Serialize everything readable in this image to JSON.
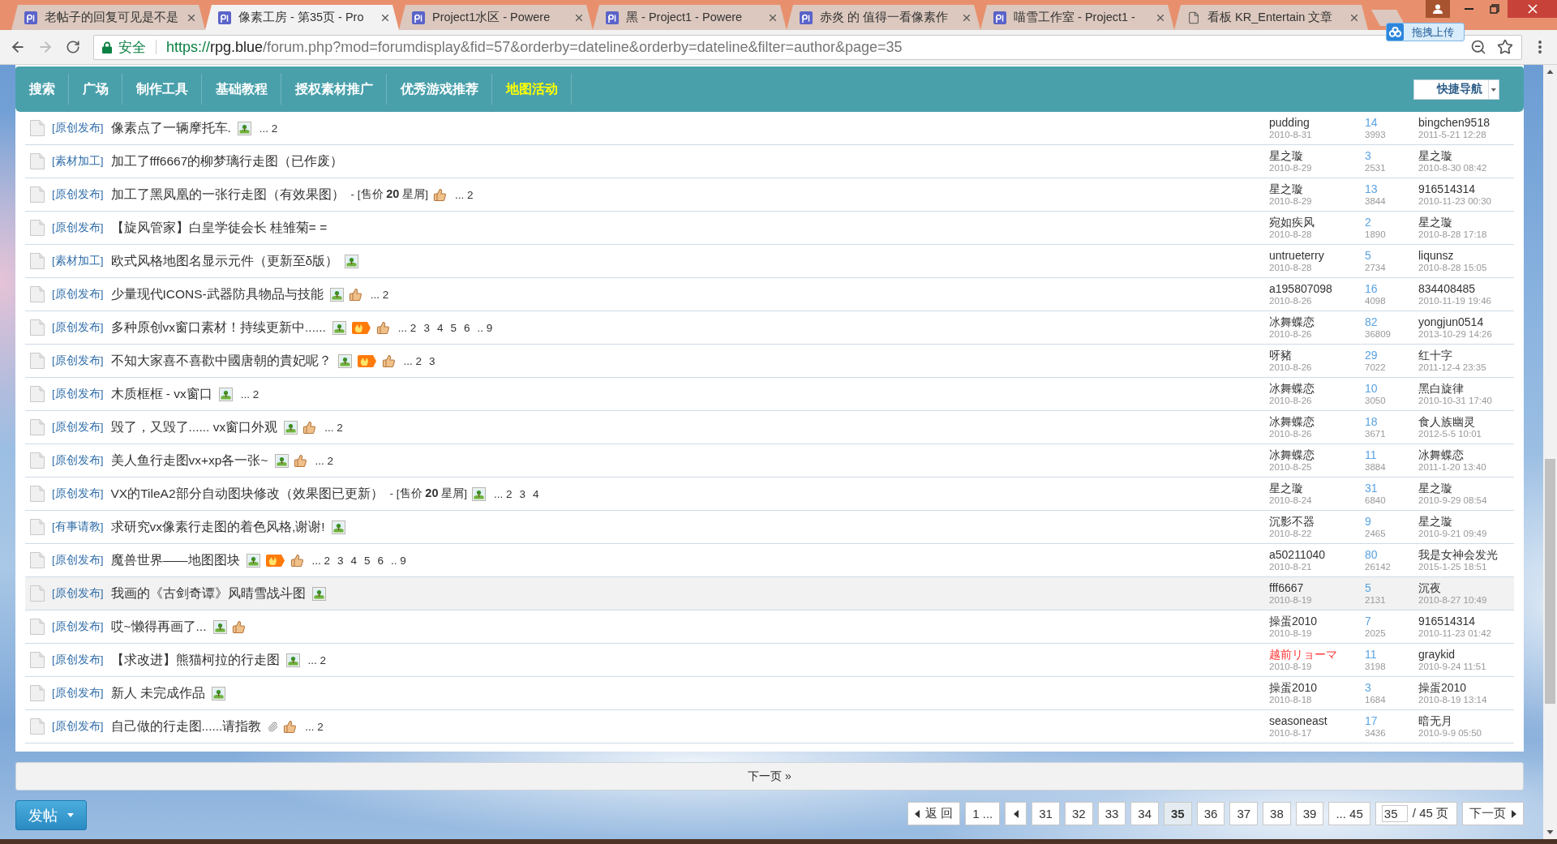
{
  "browser": {
    "tabs": [
      {
        "title": "老帖子的回复可见是不是",
        "kind": "site",
        "selected": false
      },
      {
        "title": "像素工房 - 第35页 - Pro",
        "kind": "site",
        "selected": true
      },
      {
        "title": "Project1水区 - Powere",
        "kind": "site",
        "selected": false
      },
      {
        "title": "黑 - Project1 - Powere",
        "kind": "site",
        "selected": false
      },
      {
        "title": "赤炎 的 值得一看像素作",
        "kind": "site",
        "selected": false
      },
      {
        "title": "喵雪工作室 - Project1 -",
        "kind": "site",
        "selected": false
      },
      {
        "title": "看板 KR_Entertain 文章",
        "kind": "page",
        "selected": false
      }
    ],
    "nav_buttons": [
      {
        "kind": "back",
        "disabled": false
      },
      {
        "kind": "forward",
        "disabled": true
      },
      {
        "kind": "reload",
        "disabled": false
      }
    ],
    "address_bar": {
      "security_label": "安全",
      "scheme": "https://",
      "host": "rpg.blue",
      "path": "/forum.php?mod=forumdisplay&fid=57&orderby=dateline&orderby=dateline&filter=author&page=35"
    },
    "upload_widget": {
      "label": "拖拽上传"
    }
  },
  "nav": {
    "items": [
      {
        "label": "搜索",
        "selected": false
      },
      {
        "label": "广场",
        "selected": false
      },
      {
        "label": "制作工具",
        "selected": false
      },
      {
        "label": "基础教程",
        "selected": false
      },
      {
        "label": "授权素材推广",
        "selected": false
      },
      {
        "label": "优秀游戏推荐",
        "selected": false
      },
      {
        "label": "地图活动",
        "selected": true
      }
    ],
    "quick_nav": "快捷导航"
  },
  "threads": [
    {
      "category": "[原创发布]",
      "title": "像素点了一辆摩托车.",
      "icons": [
        {
          "kind": "image"
        }
      ],
      "pages": [
        "... 2"
      ],
      "author": {
        "name": "pudding",
        "color": "#333333"
      },
      "date": "2010-8-31",
      "replies": "14",
      "views": "3993",
      "last_poster": "bingchen9518",
      "last_time": "2011-5-21 12:28",
      "highlighted": false
    },
    {
      "category": "[素材加工]",
      "title": "加工了fff6667的柳梦璃行走图（已作废）",
      "author": {
        "name": "星之璇",
        "color": "#333333"
      },
      "date": "2010-8-29",
      "replies": "3",
      "views": "2531",
      "last_poster": "星之璇",
      "last_time": "2010-8-30 08:42",
      "highlighted": false
    },
    {
      "category": "[原创发布]",
      "title": "加工了黑凤凰的一张行走图（有效果图）",
      "price": "- [售价 **20** 星屑]",
      "icons": [
        {
          "kind": "thumb"
        }
      ],
      "pages": [
        "... 2"
      ],
      "author": {
        "name": "星之璇",
        "color": "#333333"
      },
      "date": "2010-8-29",
      "replies": "13",
      "views": "3844",
      "last_poster": "916514314",
      "last_time": "2010-11-23 00:30",
      "highlighted": false
    },
    {
      "category": "[原创发布]",
      "title": "【旋风管家】白皇学徒会长 桂雏菊= =",
      "author": {
        "name": "宛如疾风",
        "color": "#333333"
      },
      "date": "2010-8-28",
      "replies": "2",
      "views": "1890",
      "last_poster": "星之璇",
      "last_time": "2010-8-28 17:18",
      "highlighted": false
    },
    {
      "category": "[素材加工]",
      "title": "欧式风格地图名显示元件（更新至δ版）",
      "icons": [
        {
          "kind": "image"
        }
      ],
      "author": {
        "name": "untrueterry",
        "color": "#333333"
      },
      "date": "2010-8-28",
      "replies": "5",
      "views": "2734",
      "last_poster": "liqunsz",
      "last_time": "2010-8-28 15:05",
      "highlighted": false
    },
    {
      "category": "[原创发布]",
      "title": "少量现代ICONS-武器防具物品与技能",
      "icons": [
        {
          "kind": "image"
        },
        {
          "kind": "thumb"
        }
      ],
      "pages": [
        "... 2"
      ],
      "author": {
        "name": "a195807098",
        "color": "#333333"
      },
      "date": "2010-8-26",
      "replies": "16",
      "views": "4098",
      "last_poster": "834408485",
      "last_time": "2010-11-19 19:46",
      "highlighted": false
    },
    {
      "category": "[原创发布]",
      "title": "多种原创vx窗口素材！持续更新中......",
      "icons": [
        {
          "kind": "image"
        },
        {
          "kind": "hot"
        },
        {
          "kind": "thumb"
        }
      ],
      "pages": [
        "... 2",
        "3",
        "4",
        "5",
        "6",
        ".. 9"
      ],
      "author": {
        "name": "冰舞蝶恋",
        "color": "#333333"
      },
      "date": "2010-8-26",
      "replies": "82",
      "views": "36809",
      "last_poster": "yongjun0514",
      "last_time": "2013-10-29 14:26",
      "highlighted": false
    },
    {
      "category": "[原创发布]",
      "title": "不知大家喜不喜歡中國唐朝的貴妃呢？",
      "icons": [
        {
          "kind": "image"
        },
        {
          "kind": "hot"
        },
        {
          "kind": "thumb"
        }
      ],
      "pages": [
        "... 2",
        "3"
      ],
      "author": {
        "name": "呀豬",
        "color": "#333333"
      },
      "date": "2010-8-26",
      "replies": "29",
      "views": "7022",
      "last_poster": "红十字",
      "last_time": "2011-12-4 23:35",
      "highlighted": false
    },
    {
      "category": "[原创发布]",
      "title": "木质框框 - vx窗口",
      "icons": [
        {
          "kind": "image"
        }
      ],
      "pages": [
        "... 2"
      ],
      "author": {
        "name": "冰舞蝶恋",
        "color": "#333333"
      },
      "date": "2010-8-26",
      "replies": "10",
      "views": "3050",
      "last_poster": "黑白旋律",
      "last_time": "2010-10-31 17:40",
      "highlighted": false
    },
    {
      "category": "[原创发布]",
      "title": "毁了，又毁了...... vx窗口外观",
      "icons": [
        {
          "kind": "image"
        },
        {
          "kind": "thumb"
        }
      ],
      "pages": [
        "... 2"
      ],
      "author": {
        "name": "冰舞蝶恋",
        "color": "#333333"
      },
      "date": "2010-8-26",
      "replies": "18",
      "views": "3671",
      "last_poster": "食人族幽灵",
      "last_time": "2012-5-5 10:01",
      "highlighted": false
    },
    {
      "category": "[原创发布]",
      "title": "美人鱼行走图vx+xp各一张~",
      "icons": [
        {
          "kind": "image"
        },
        {
          "kind": "thumb"
        }
      ],
      "pages": [
        "... 2"
      ],
      "author": {
        "name": "冰舞蝶恋",
        "color": "#333333"
      },
      "date": "2010-8-25",
      "replies": "11",
      "views": "3884",
      "last_poster": "冰舞蝶恋",
      "last_time": "2011-1-20 13:40",
      "highlighted": false
    },
    {
      "category": "[原创发布]",
      "title": "VX的TileA2部分自动图块修改（效果图已更新）",
      "price": "- [售价 **20** 星屑]",
      "icons": [
        {
          "kind": "image"
        }
      ],
      "pages": [
        "... 2",
        "3",
        "4"
      ],
      "author": {
        "name": "星之璇",
        "color": "#333333"
      },
      "date": "2010-8-24",
      "replies": "31",
      "views": "6840",
      "last_poster": "星之璇",
      "last_time": "2010-9-29 08:54",
      "highlighted": false
    },
    {
      "category": "[有事请教]",
      "title": "求研究vx像素行走图的着色风格,谢谢!",
      "icons": [
        {
          "kind": "image"
        }
      ],
      "author": {
        "name": "沉影不器",
        "color": "#333333"
      },
      "date": "2010-8-22",
      "replies": "9",
      "views": "2465",
      "last_poster": "星之璇",
      "last_time": "2010-9-21 09:49",
      "highlighted": false
    },
    {
      "category": "[原创发布]",
      "title": "魔兽世界——地图图块",
      "icons": [
        {
          "kind": "image"
        },
        {
          "kind": "hot"
        },
        {
          "kind": "thumb"
        }
      ],
      "pages": [
        "... 2",
        "3",
        "4",
        "5",
        "6",
        ".. 9"
      ],
      "author": {
        "name": "a50211040",
        "color": "#333333"
      },
      "date": "2010-8-21",
      "replies": "80",
      "views": "26142",
      "last_poster": "我是女神会发光",
      "last_time": "2015-1-25 18:51",
      "highlighted": false
    },
    {
      "category": "[原创发布]",
      "title": "我画的《古剑奇谭》风晴雪战斗图",
      "icons": [
        {
          "kind": "image"
        }
      ],
      "author": {
        "name": "fff6667",
        "color": "#333333"
      },
      "date": "2010-8-19",
      "replies": "5",
      "views": "2131",
      "last_poster": "沉夜",
      "last_time": "2010-8-27 10:49",
      "highlighted": true
    },
    {
      "category": "[原创发布]",
      "title": "哎~懒得再画了...",
      "icons": [
        {
          "kind": "image"
        },
        {
          "kind": "thumb"
        }
      ],
      "author": {
        "name": "操蛋2010",
        "color": "#333333"
      },
      "date": "2010-8-19",
      "replies": "7",
      "views": "2025",
      "last_poster": "916514314",
      "last_time": "2010-11-23 01:42",
      "highlighted": false
    },
    {
      "category": "[原创发布]",
      "title": "【求改进】熊猫柯拉的行走图",
      "icons": [
        {
          "kind": "image"
        }
      ],
      "pages": [
        "... 2"
      ],
      "author": {
        "name": "越前リョーマ",
        "color": "#ff3333"
      },
      "date": "2010-8-19",
      "replies": "11",
      "views": "3198",
      "last_poster": "graykid",
      "last_time": "2010-9-24 11:51",
      "highlighted": false
    },
    {
      "category": "[原创发布]",
      "title": "新人 未完成作品",
      "icons": [
        {
          "kind": "image"
        }
      ],
      "author": {
        "name": "操蛋2010",
        "color": "#333333"
      },
      "date": "2010-8-18",
      "replies": "3",
      "views": "1684",
      "last_poster": "操蛋2010",
      "last_time": "2010-8-19 13:14",
      "highlighted": false
    },
    {
      "category": "[原创发布]",
      "title": "自己做的行走图......请指教",
      "icons": [
        {
          "kind": "attachment"
        },
        {
          "kind": "thumb"
        }
      ],
      "pages": [
        "... 2"
      ],
      "author": {
        "name": "seasoneast",
        "color": "#333333"
      },
      "date": "2010-8-17",
      "replies": "17",
      "views": "3436",
      "last_poster": "暗无月",
      "last_time": "2010-9-9 05:50",
      "highlighted": false
    }
  ],
  "next_page": "下一页 »",
  "post_button": "发帖",
  "pagination": {
    "items": [
      {
        "kind": "back",
        "label": "返 回",
        "selected": false
      },
      {
        "kind": "page",
        "label": "1 ...",
        "selected": false
      },
      {
        "kind": "prev",
        "selected": false
      },
      {
        "kind": "page",
        "label": "31",
        "selected": false
      },
      {
        "kind": "page",
        "label": "32",
        "selected": false
      },
      {
        "kind": "page",
        "label": "33",
        "selected": false
      },
      {
        "kind": "page",
        "label": "34",
        "selected": false
      },
      {
        "kind": "page",
        "label": "35",
        "selected": true
      },
      {
        "kind": "page",
        "label": "36",
        "selected": false
      },
      {
        "kind": "page",
        "label": "37",
        "selected": false
      },
      {
        "kind": "page",
        "label": "38",
        "selected": false
      },
      {
        "kind": "page",
        "label": "39",
        "selected": false
      },
      {
        "kind": "page",
        "label": "... 45",
        "selected": false
      },
      {
        "kind": "jump",
        "value": "35",
        "suffix": "/ 45 页",
        "selected": false
      },
      {
        "kind": "next",
        "label": "下一页",
        "selected": false
      }
    ]
  }
}
